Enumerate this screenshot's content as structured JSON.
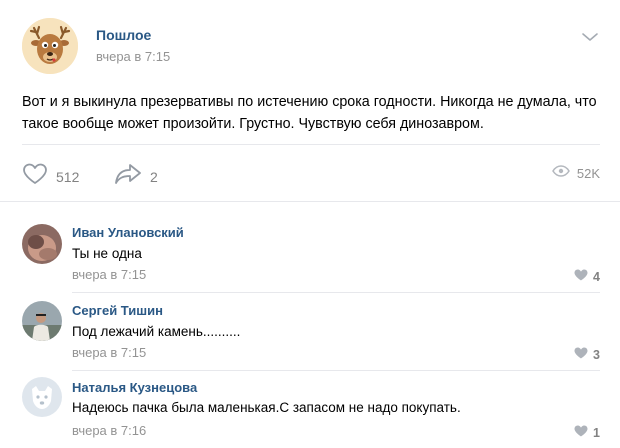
{
  "post": {
    "community_name": "Пошлое",
    "time": "вчера в 7:15",
    "text": "Вот и я выкинула презервативы по истечению срока годности. Никогда не думала, что такое вообще может произойти. Грустно. Чувствую себя динозавром.",
    "likes": "512",
    "shares": "2",
    "views": "52K"
  },
  "comments": [
    {
      "author": "Иван Улановский",
      "text": "Ты не одна",
      "time": "вчера в 7:15",
      "likes": "4"
    },
    {
      "author": "Сергей Тишин",
      "text": "Под лежачий камень..........",
      "time": "вчера в 7:15",
      "likes": "3"
    },
    {
      "author": "Наталья Кузнецова",
      "text": "Надеюсь пачка была маленькая.С запасом не надо покупать.",
      "time": "вчера в 7:16",
      "likes": "1"
    }
  ],
  "icons": {
    "like": "heart-icon",
    "share": "share-arrow-icon",
    "views": "eye-icon",
    "menu": "chevron-down-icon"
  },
  "colors": {
    "link": "#2a5885",
    "muted": "#939393",
    "divider": "#e7e8ec"
  }
}
